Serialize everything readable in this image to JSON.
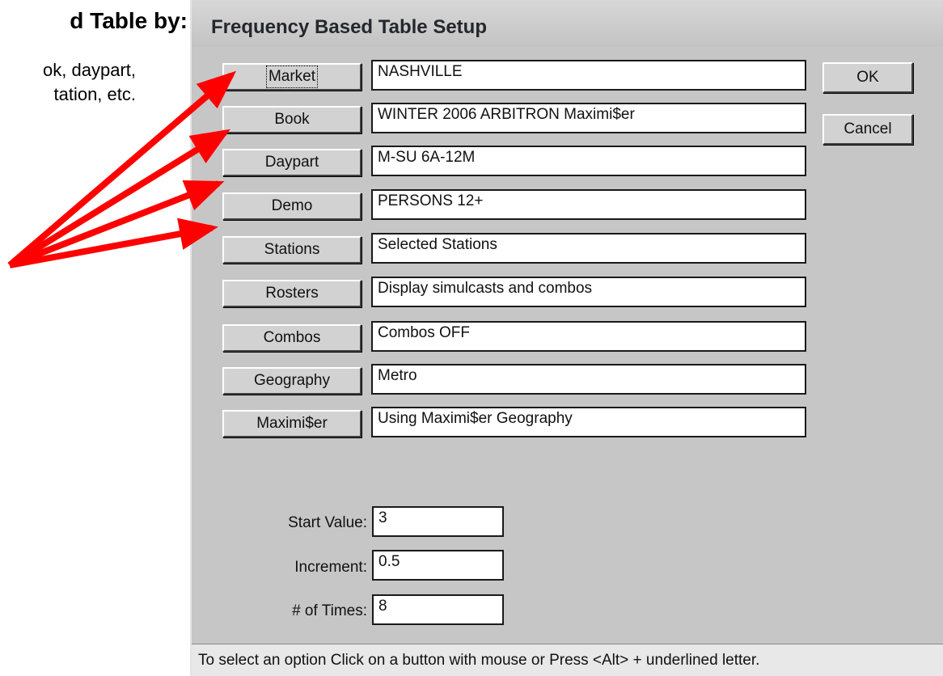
{
  "slide": {
    "heading": "d Table by:",
    "note_lines": [
      "ok, daypart,",
      "tation, etc."
    ]
  },
  "dialog": {
    "title": "Frequency Based Table Setup",
    "ok_label": "OK",
    "cancel_label": "Cancel",
    "options": [
      {
        "button": "Market",
        "value": "NASHVILLE"
      },
      {
        "button": "Book",
        "value": "WINTER 2006 ARBITRON Maximi$er"
      },
      {
        "button": "Daypart",
        "value": "M-SU 6A-12M"
      },
      {
        "button": "Demo",
        "value": "PERSONS 12+"
      },
      {
        "button": "Stations",
        "value": "Selected Stations"
      },
      {
        "button": "Rosters",
        "value": "Display simulcasts and combos"
      },
      {
        "button": "Combos",
        "value": "Combos OFF"
      },
      {
        "button": "Geography",
        "value": "Metro"
      },
      {
        "button": "Maximi$er",
        "value": "Using Maximi$er Geography"
      }
    ],
    "params": [
      {
        "label": "Start Value:",
        "value": "3"
      },
      {
        "label": "Increment:",
        "value": "0.5"
      },
      {
        "label": "# of Times:",
        "value": "8"
      }
    ],
    "status": "To select an option Click on a button with mouse or Press <Alt> + underlined letter."
  },
  "colors": {
    "arrow": "#ff0000",
    "dialog_face": "#c6c6c6"
  }
}
